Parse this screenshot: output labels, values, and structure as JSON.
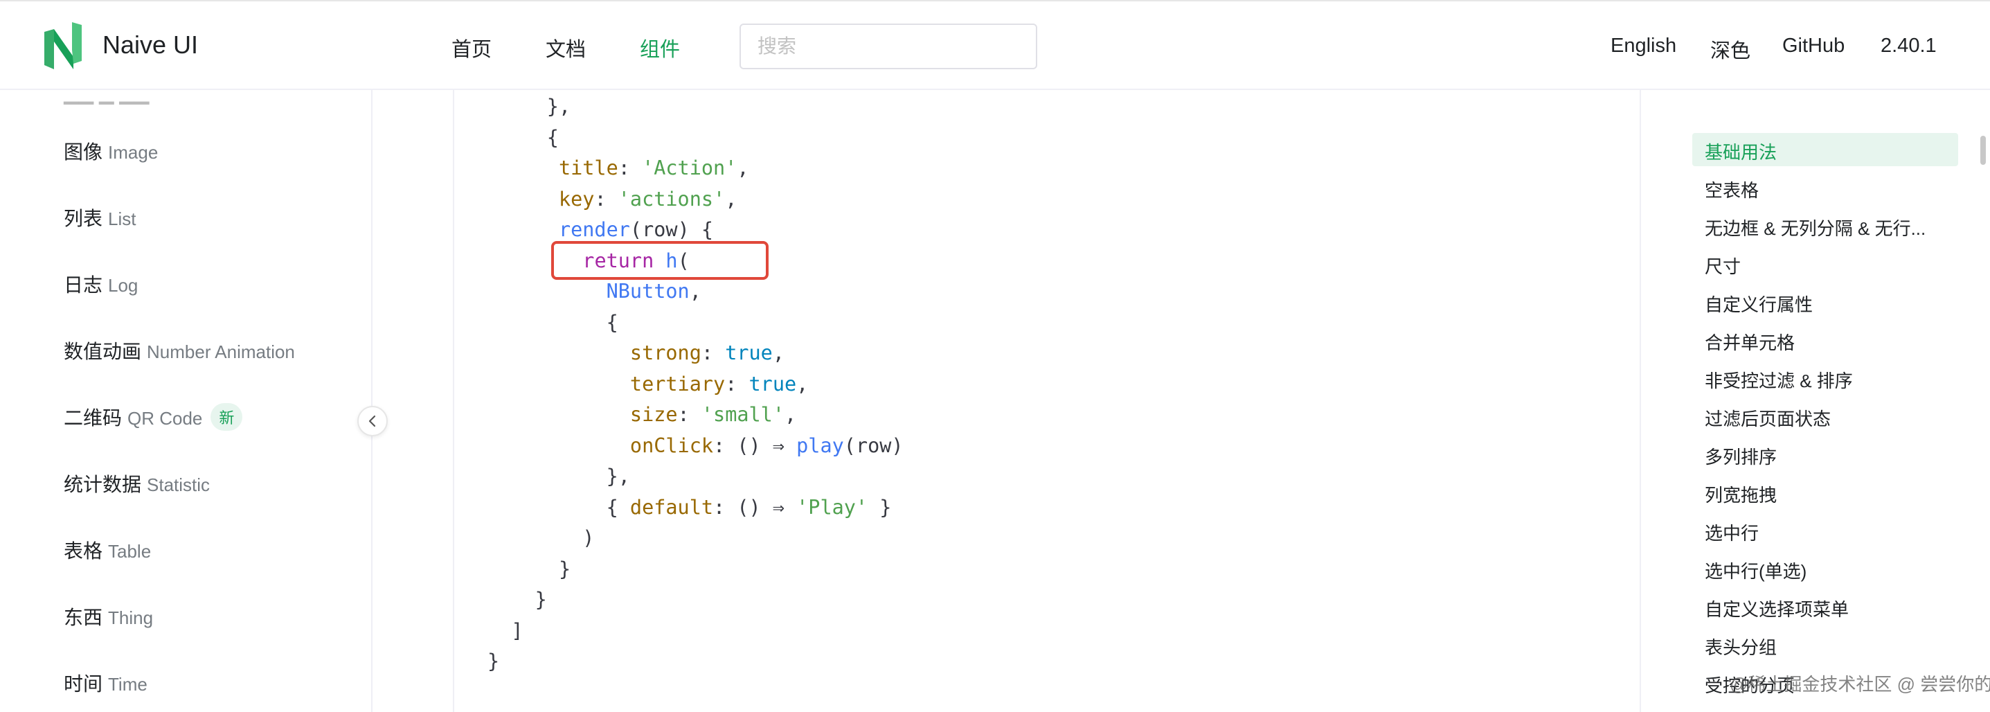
{
  "header": {
    "brand": "Naive UI",
    "nav": [
      "首页",
      "文档",
      "组件"
    ],
    "search_placeholder": "搜索",
    "right": [
      "English",
      "深色",
      "GitHub",
      "2.40.1"
    ]
  },
  "sidebar": {
    "items": [
      {
        "zh": "图像",
        "en": "Image"
      },
      {
        "zh": "列表",
        "en": "List"
      },
      {
        "zh": "日志",
        "en": "Log"
      },
      {
        "zh": "数值动画",
        "en": "Number Animation"
      },
      {
        "zh": "二维码",
        "en": "QR Code",
        "badge": "新"
      },
      {
        "zh": "统计数据",
        "en": "Statistic"
      },
      {
        "zh": "表格",
        "en": "Table"
      },
      {
        "zh": "东西",
        "en": "Thing"
      },
      {
        "zh": "时间",
        "en": "Time"
      }
    ]
  },
  "code": {
    "line0": "  },",
    "line1": "  {",
    "title_key": "title",
    "title_val": "'Action'",
    "key_key": "key",
    "key_val": "'actions'",
    "render_fn": "render",
    "render_arg": "row",
    "return_kw": "return",
    "h_fn": "h",
    "nbutton": "NButton",
    "strong_key": "strong",
    "strong_val": "true",
    "tertiary_key": "tertiary",
    "tertiary_val": "true",
    "size_key": "size",
    "size_val": "'small'",
    "onclick_key": "onClick",
    "play_fn": "play",
    "default_key": "default",
    "play_str": "'Play'"
  },
  "anchor": {
    "items": [
      "基础用法",
      "空表格",
      "无边框 & 无列分隔 & 无行...",
      "尺寸",
      "自定义行属性",
      "合并单元格",
      "非受控过滤 & 排序",
      "过滤后页面状态",
      "多列排序",
      "列宽拖拽",
      "选中行",
      "选中行(单选)",
      "自定义选择项菜单",
      "表头分组",
      "受控的分页"
    ]
  },
  "watermark": "@稀土掘金技术社区 @ 尝尝你的优乐美",
  "colors": {
    "accent": "#18a058",
    "highlight_box": "#e0483a"
  }
}
